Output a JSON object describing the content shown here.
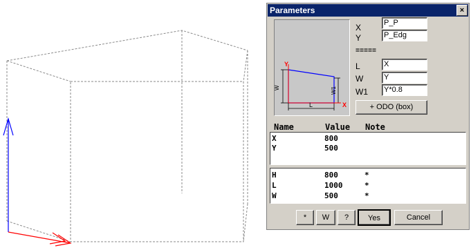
{
  "dialog": {
    "title": "Parameters",
    "close_glyph": "×"
  },
  "preview": {
    "labels": {
      "y": "Y",
      "w": "W",
      "w1": "W1",
      "l": "L",
      "x": "X"
    },
    "colors": {
      "edge": "#0000ff",
      "outline": "#000000",
      "axis_y": "#ff0000",
      "axis_x": "#ff0000"
    }
  },
  "fields": {
    "x": {
      "label": "X",
      "value": "P_P"
    },
    "y": {
      "label": "Y",
      "value": "P_Edg"
    },
    "separator": "=====",
    "l": {
      "label": "L",
      "value": "X"
    },
    "w": {
      "label": "W",
      "value": "Y"
    },
    "w1": {
      "label": "W1",
      "value": "Y*0.8"
    }
  },
  "odo_button": "+ ODO (box)",
  "list_header": {
    "name": "Name",
    "value": "Value",
    "note": "Note"
  },
  "list_top": [
    {
      "name": "X",
      "value": "800",
      "note": ""
    },
    {
      "name": "Y",
      "value": "500",
      "note": ""
    }
  ],
  "list_bottom": [
    {
      "name": "H",
      "value": "800",
      "note": "*"
    },
    {
      "name": "L",
      "value": "1000",
      "note": "*"
    },
    {
      "name": "W",
      "value": "500",
      "note": "*"
    }
  ],
  "buttons": {
    "star": "*",
    "w": "W",
    "help": "?",
    "yes": "Yes",
    "cancel": "Cancel"
  },
  "viewport_colors": {
    "box": "#8a8a8a",
    "axis_z": "#0000ff",
    "axis_x": "#ff0000"
  }
}
